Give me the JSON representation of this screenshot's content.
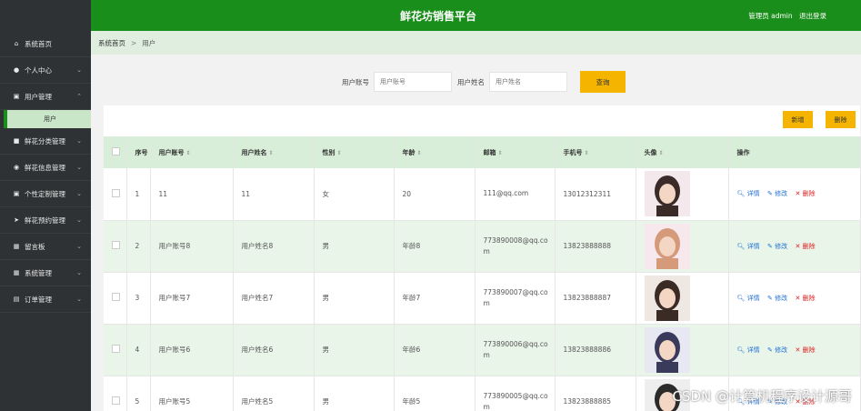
{
  "header": {
    "title": "鲜花坊销售平台",
    "user_label": "管理员 admin",
    "logout": "退出登录",
    "colors": {
      "bar": "#1a8e1a",
      "sidebar": "#2f3234",
      "accent": "#f5b400"
    }
  },
  "sidebar": {
    "items": [
      {
        "label": "系统首页",
        "icon": "home-icon"
      },
      {
        "label": "个人中心",
        "icon": "user-icon"
      },
      {
        "label": "用户管理",
        "icon": "clipboard-icon"
      },
      {
        "label": "鲜花分类管理",
        "icon": "folder-icon"
      },
      {
        "label": "鲜花信息管理",
        "icon": "pin-icon"
      },
      {
        "label": "个性定制管理",
        "icon": "clipboard-icon"
      },
      {
        "label": "鲜花预约管理",
        "icon": "send-icon"
      },
      {
        "label": "留言板",
        "icon": "grid-icon"
      },
      {
        "label": "系统管理",
        "icon": "grid-icon"
      },
      {
        "label": "订单管理",
        "icon": "table-icon"
      }
    ],
    "sub_item": "用户"
  },
  "breadcrumb": {
    "home": "系统首页",
    "current": "用户"
  },
  "search": {
    "account_label": "用户账号",
    "account_placeholder": "用户账号",
    "name_label": "用户姓名",
    "name_placeholder": "用户姓名",
    "query_button": "查询"
  },
  "actions": {
    "add": "新增",
    "delete": "删除"
  },
  "table": {
    "headers": [
      "序号",
      "用户账号",
      "用户姓名",
      "性别",
      "年龄",
      "邮箱",
      "手机号",
      "头像",
      "操作"
    ],
    "rows": [
      {
        "no": "1",
        "account": "11",
        "name": "11",
        "gender": "女",
        "age": "20",
        "email": "111@qq.com",
        "phone": "13012312311"
      },
      {
        "no": "2",
        "account": "用户账号8",
        "name": "用户姓名8",
        "gender": "男",
        "age": "年龄8",
        "email": "773890008@qq.co\nm",
        "phone": "13823888888"
      },
      {
        "no": "3",
        "account": "用户账号7",
        "name": "用户姓名7",
        "gender": "男",
        "age": "年龄7",
        "email": "773890007@qq.co\nm",
        "phone": "13823888887"
      },
      {
        "no": "4",
        "account": "用户账号6",
        "name": "用户姓名6",
        "gender": "男",
        "age": "年龄6",
        "email": "773890006@qq.co\nm",
        "phone": "13823888886"
      },
      {
        "no": "5",
        "account": "用户账号5",
        "name": "用户姓名5",
        "gender": "男",
        "age": "年龄5",
        "email": "773890005@qq.co\nm",
        "phone": "13823888885"
      }
    ],
    "ops": {
      "detail": "详情",
      "edit": "修改",
      "delete": "删除"
    }
  },
  "watermark": "CSDN @计算机程序设计源哥"
}
